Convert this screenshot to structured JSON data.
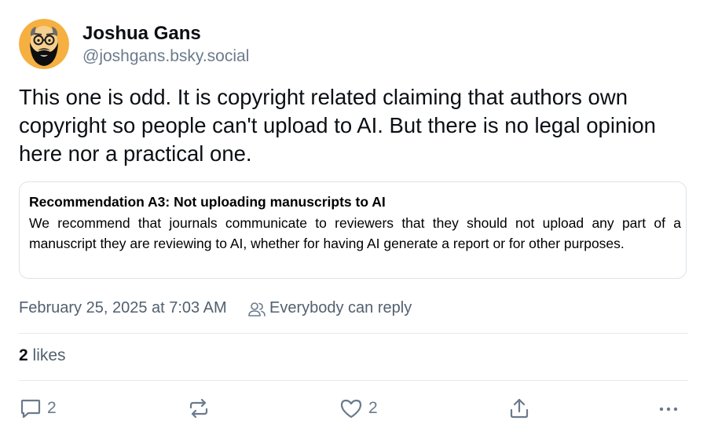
{
  "author": {
    "display_name": "Joshua Gans",
    "handle": "@joshgans.bsky.social"
  },
  "post": {
    "text": "This one is odd. It is copyright related claiming that authors own copyright so people can't upload to AI. But there is no legal opinion here nor a practical one."
  },
  "quote_image": {
    "title": "Recommendation A3: Not uploading manuscripts to AI",
    "body": "We recommend that journals communicate to reviewers that they should not upload any part of a manuscript they are reviewing to AI, whether for having AI generate a report or for other purposes."
  },
  "meta": {
    "timestamp": "February 25, 2025 at 7:03 AM",
    "reply_setting": "Everybody can reply"
  },
  "likes": {
    "count": "2",
    "label": "likes"
  },
  "actions": {
    "reply_count": "2",
    "like_count": "2"
  },
  "icons": {
    "reply": "speech-bubble-icon",
    "repost": "repost-arrows-icon",
    "like": "heart-outline-icon",
    "share": "share-upload-icon",
    "more": "ellipsis-icon",
    "reply_setting": "people-icon"
  },
  "colors": {
    "text": "#0b0f14",
    "muted": "#6b7a8c",
    "border": "#dde3ea"
  }
}
